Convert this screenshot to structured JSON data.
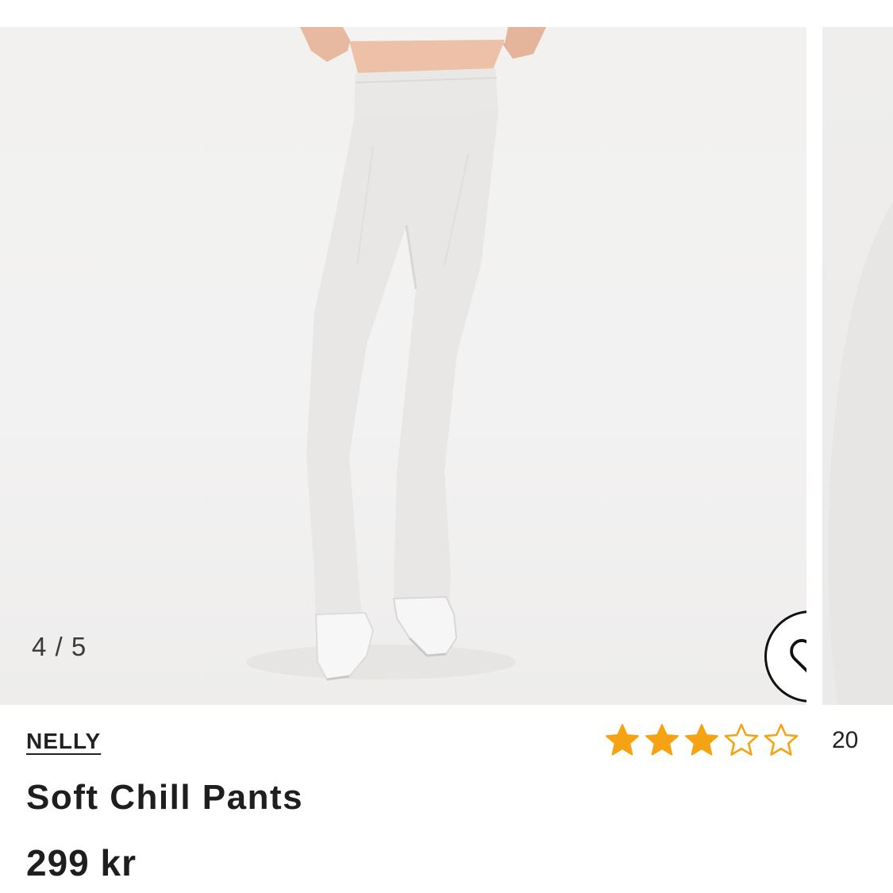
{
  "gallery": {
    "counter": "4 / 5",
    "favorite_icon": "heart-outline-icon"
  },
  "product": {
    "brand": "NELLY",
    "name": "Soft Chill Pants",
    "price": "299 kr"
  },
  "rating": {
    "stars_filled": 3,
    "stars_total": 5,
    "review_count": "20",
    "star_color": "#f5a315"
  },
  "colors": {
    "background": "#ffffff",
    "photo_background": "#f2f1f0",
    "text": "#1e1e1e"
  }
}
